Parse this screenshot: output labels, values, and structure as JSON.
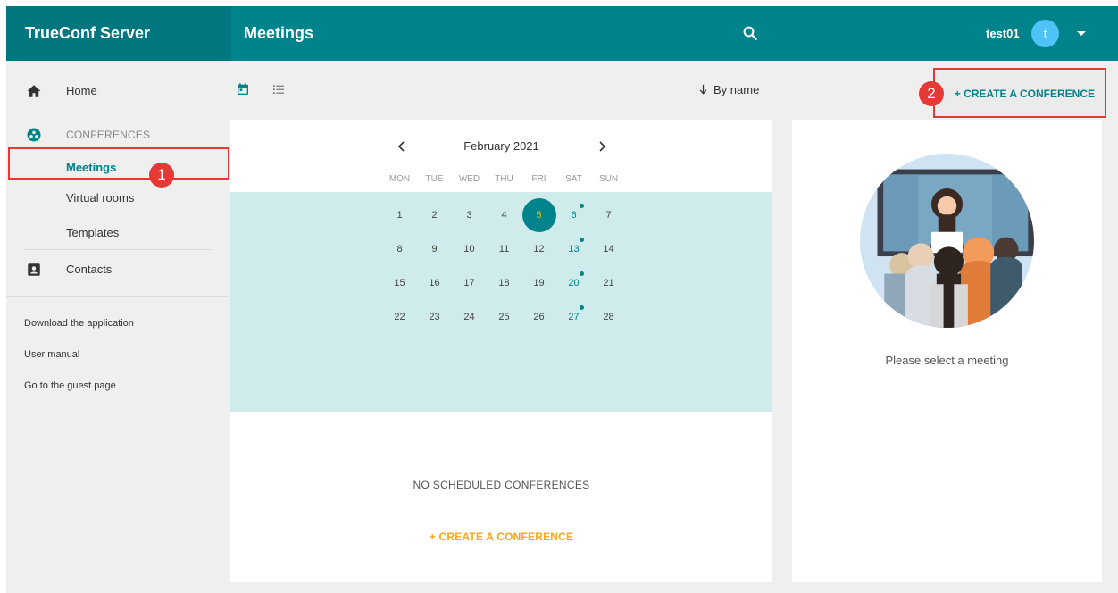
{
  "app": {
    "brand": "TrueConf Server",
    "page_title": "Meetings"
  },
  "user": {
    "name": "test01",
    "avatar_letter": "t"
  },
  "sidebar": {
    "home": "Home",
    "conferences_header": "CONFERENCES",
    "conference_items": [
      "Meetings",
      "Virtual rooms",
      "Templates"
    ],
    "contacts": "Contacts",
    "links": [
      "Download the application",
      "User manual",
      "Go to the guest page"
    ]
  },
  "toolbar": {
    "sort_label": "By name",
    "create_button": "+ CREATE A CONFERENCE"
  },
  "calendar": {
    "month": "February 2021",
    "weekdays": [
      "MON",
      "TUE",
      "WED",
      "THU",
      "FRI",
      "SAT",
      "SUN"
    ],
    "weeks": [
      [
        "1",
        "2",
        "3",
        "4",
        "5",
        "6",
        "7"
      ],
      [
        "8",
        "9",
        "10",
        "11",
        "12",
        "13",
        "14"
      ],
      [
        "15",
        "16",
        "17",
        "18",
        "19",
        "20",
        "21"
      ],
      [
        "22",
        "23",
        "24",
        "25",
        "26",
        "27",
        "28"
      ]
    ],
    "selected_day": "5",
    "marked_days": [
      "6",
      "13",
      "20",
      "27"
    ]
  },
  "empty_state": {
    "message": "NO SCHEDULED CONFERENCES",
    "create_link": "+ CREATE A CONFERENCE"
  },
  "detail": {
    "message": "Please select a meeting"
  },
  "callouts": [
    "1",
    "2"
  ],
  "colors": {
    "primary": "#00838a",
    "accent": "#f5a623",
    "today_text": "#f0c419",
    "callout": "#e53935"
  }
}
